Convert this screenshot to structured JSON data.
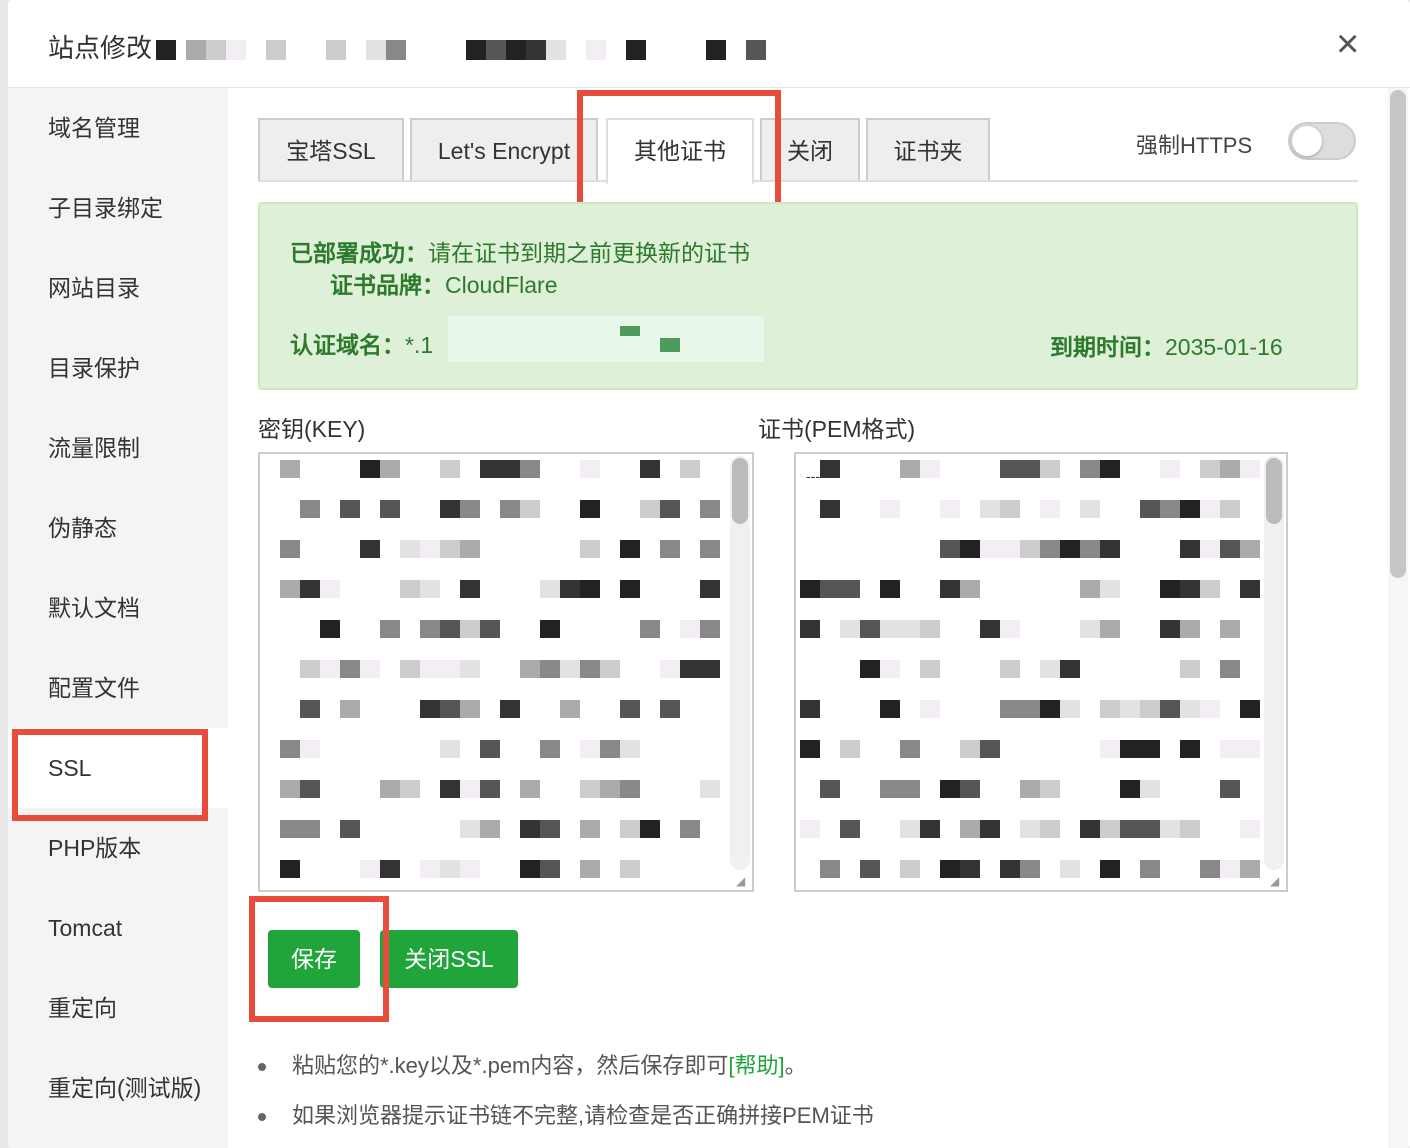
{
  "dialog": {
    "title": "站点修改",
    "close_icon": "×"
  },
  "sidebar": {
    "items": [
      {
        "label": "域名管理"
      },
      {
        "label": "子目录绑定"
      },
      {
        "label": "网站目录"
      },
      {
        "label": "目录保护"
      },
      {
        "label": "流量限制"
      },
      {
        "label": "伪静态"
      },
      {
        "label": "默认文档"
      },
      {
        "label": "配置文件"
      },
      {
        "label": "SSL",
        "active": true
      },
      {
        "label": "PHP版本"
      },
      {
        "label": "Tomcat"
      },
      {
        "label": "重定向"
      },
      {
        "label": "重定向(测试版)"
      }
    ]
  },
  "tabs": [
    {
      "label": "宝塔SSL"
    },
    {
      "label": "Let's Encrypt"
    },
    {
      "label": "其他证书",
      "active": true
    },
    {
      "label": "关闭"
    },
    {
      "label": "证书夹"
    }
  ],
  "force_https": {
    "label": "强制HTTPS",
    "enabled": false
  },
  "status": {
    "deployed_label": "已部署成功：",
    "deployed_text": "请在证书到期之前更换新的证书",
    "brand_label": "证书品牌：",
    "brand_value": "CloudFlare",
    "domain_label": "认证域名：",
    "domain_value": "*.1",
    "expire_label": "到期时间：",
    "expire_value": "2035-01-16"
  },
  "fields": {
    "key_label": "密钥(KEY)",
    "cert_label": "证书(PEM格式)",
    "cert_prefix": "---"
  },
  "buttons": {
    "save": "保存",
    "disable_ssl": "关闭SSL"
  },
  "tips": {
    "tip1_text": "粘贴您的*.key以及*.pem内容，然后保存即可",
    "tip1_help": "[帮助]",
    "tip1_end": "。",
    "tip2_text": "如果浏览器提示证书链不完整,请检查是否正确拼接PEM证书"
  },
  "colors": {
    "accent": "#20a53a",
    "highlight_box": "#e74c3c",
    "success_bg": "#dff0d8"
  }
}
